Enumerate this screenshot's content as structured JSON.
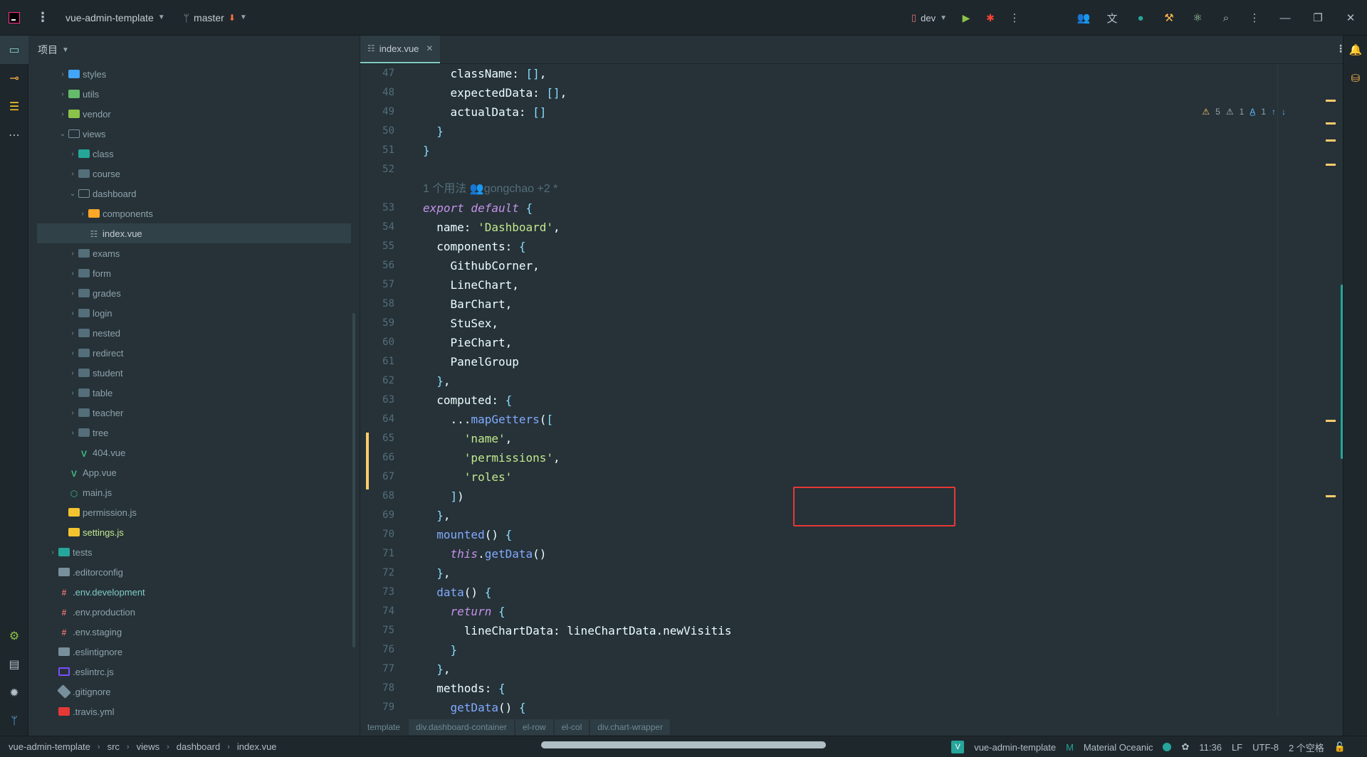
{
  "titlebar": {
    "project": "vue-admin-template",
    "branch": "master",
    "run_config": "dev"
  },
  "project_panel": {
    "header": "项目",
    "tree": [
      {
        "label": "styles",
        "depth": 2,
        "icon": "folder-blue",
        "expanded": false
      },
      {
        "label": "utils",
        "depth": 2,
        "icon": "folder-green",
        "expanded": false
      },
      {
        "label": "vendor",
        "depth": 2,
        "icon": "folder-lime",
        "expanded": false
      },
      {
        "label": "views",
        "depth": 2,
        "icon": "folder-open-yellow",
        "expanded": true
      },
      {
        "label": "class",
        "depth": 3,
        "icon": "folder-teal",
        "expanded": false
      },
      {
        "label": "course",
        "depth": 3,
        "icon": "folder",
        "expanded": false
      },
      {
        "label": "dashboard",
        "depth": 3,
        "icon": "folder-open",
        "expanded": true
      },
      {
        "label": "components",
        "depth": 4,
        "icon": "folder-yellow",
        "expanded": false
      },
      {
        "label": "index.vue",
        "depth": 4,
        "icon": "vue-lines",
        "selected": true
      },
      {
        "label": "exams",
        "depth": 3,
        "icon": "folder",
        "expanded": false
      },
      {
        "label": "form",
        "depth": 3,
        "icon": "folder",
        "expanded": false
      },
      {
        "label": "grades",
        "depth": 3,
        "icon": "folder",
        "expanded": false
      },
      {
        "label": "login",
        "depth": 3,
        "icon": "folder",
        "expanded": false
      },
      {
        "label": "nested",
        "depth": 3,
        "icon": "folder",
        "expanded": false
      },
      {
        "label": "redirect",
        "depth": 3,
        "icon": "folder",
        "expanded": false
      },
      {
        "label": "student",
        "depth": 3,
        "icon": "folder",
        "expanded": false
      },
      {
        "label": "table",
        "depth": 3,
        "icon": "folder",
        "expanded": false
      },
      {
        "label": "teacher",
        "depth": 3,
        "icon": "folder",
        "expanded": false
      },
      {
        "label": "tree",
        "depth": 3,
        "icon": "folder",
        "expanded": false
      },
      {
        "label": "404.vue",
        "depth": 3,
        "icon": "vue"
      },
      {
        "label": "App.vue",
        "depth": 2,
        "icon": "vue"
      },
      {
        "label": "main.js",
        "depth": 2,
        "icon": "node-js"
      },
      {
        "label": "permission.js",
        "depth": 2,
        "icon": "js"
      },
      {
        "label": "settings.js",
        "depth": 2,
        "icon": "js",
        "highlight": true
      },
      {
        "label": "tests",
        "depth": 1,
        "icon": "folder-teal",
        "expanded": false
      },
      {
        "label": ".editorconfig",
        "depth": 1,
        "icon": "config"
      },
      {
        "label": ".env.development",
        "depth": 1,
        "icon": "env",
        "highlight": true
      },
      {
        "label": ".env.production",
        "depth": 1,
        "icon": "env"
      },
      {
        "label": ".env.staging",
        "depth": 1,
        "icon": "env"
      },
      {
        "label": ".eslintignore",
        "depth": 1,
        "icon": "config"
      },
      {
        "label": ".eslintrc.js",
        "depth": 1,
        "icon": "eslint"
      },
      {
        "label": ".gitignore",
        "depth": 1,
        "icon": "git"
      },
      {
        "label": ".travis.yml",
        "depth": 1,
        "icon": "travis"
      }
    ]
  },
  "editor": {
    "tab": "index.vue",
    "inspections": {
      "warnings": "5",
      "weak_warnings": "1",
      "typos": "1"
    },
    "lines": [
      {
        "n": "47",
        "code": "    className: [],"
      },
      {
        "n": "48",
        "code": "    expectedData: [],"
      },
      {
        "n": "49",
        "code": "    actualData: []"
      },
      {
        "n": "50",
        "code": "  }"
      },
      {
        "n": "51",
        "code": "}"
      },
      {
        "n": "52",
        "code": ""
      },
      {
        "n": "",
        "inlay": "1 个用法   👥gongchao +2 *"
      },
      {
        "n": "53",
        "code": "export default {"
      },
      {
        "n": "54",
        "code": "  name: 'Dashboard',"
      },
      {
        "n": "55",
        "code": "  components: {"
      },
      {
        "n": "56",
        "code": "    GithubCorner,"
      },
      {
        "n": "57",
        "code": "    LineChart,"
      },
      {
        "n": "58",
        "code": "    BarChart,"
      },
      {
        "n": "59",
        "code": "    StuSex,"
      },
      {
        "n": "60",
        "code": "    PieChart,"
      },
      {
        "n": "61",
        "code": "    PanelGroup"
      },
      {
        "n": "62",
        "code": "  },"
      },
      {
        "n": "63",
        "code": "  computed: {"
      },
      {
        "n": "64",
        "code": "    ...mapGetters(["
      },
      {
        "n": "65",
        "code": "      'name',"
      },
      {
        "n": "66",
        "code": "      'permissions',"
      },
      {
        "n": "67",
        "code": "      'roles'"
      },
      {
        "n": "68",
        "code": "    ])"
      },
      {
        "n": "69",
        "code": "  },"
      },
      {
        "n": "70",
        "code": "  mounted() {"
      },
      {
        "n": "71",
        "code": "    this.getData()"
      },
      {
        "n": "72",
        "code": "  },"
      },
      {
        "n": "73",
        "code": "  data() {"
      },
      {
        "n": "74",
        "code": "    return {"
      },
      {
        "n": "75",
        "code": "      lineChartData: lineChartData.newVisitis"
      },
      {
        "n": "76",
        "code": "    }"
      },
      {
        "n": "77",
        "code": "  },"
      },
      {
        "n": "78",
        "code": "  methods: {"
      },
      {
        "n": "79",
        "code": "    getData() {"
      }
    ],
    "breadcrumb": [
      "template",
      "div.dashboard-container",
      "el-row",
      "el-col",
      "div.chart-wrapper"
    ]
  },
  "statusbar": {
    "path": [
      "vue-admin-template",
      "src",
      "views",
      "dashboard",
      "index.vue"
    ],
    "project_badge": "vue-admin-template",
    "theme": "Material Oceanic",
    "position": "11:36",
    "line_sep": "LF",
    "encoding": "UTF-8",
    "indent": "2 个空格"
  },
  "colors": {
    "accent": "#80CBC4",
    "keyword": "#C792EA",
    "string": "#C3E88D",
    "function": "#82AAFF",
    "highlight_box": "#E53935"
  }
}
